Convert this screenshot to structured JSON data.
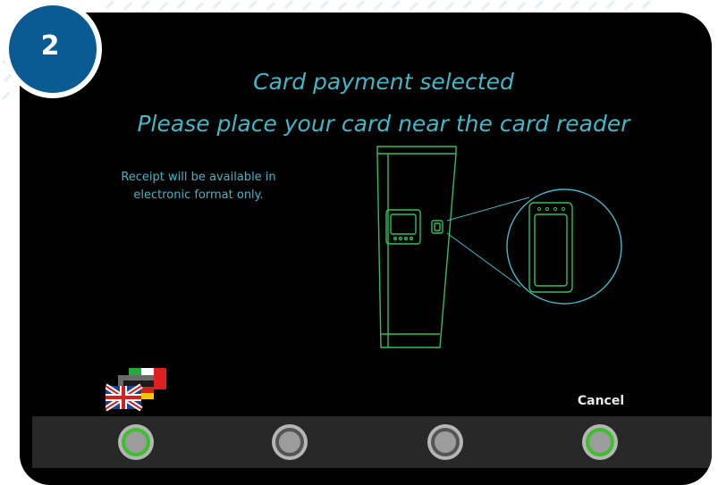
{
  "step": {
    "number": "2"
  },
  "headline": {
    "line1": "Card payment selected",
    "line2": "Please place your card near the card reader"
  },
  "receipt_note": {
    "line1": "Receipt will be available in",
    "line2": "electronic format only."
  },
  "language_selector": {
    "icon": "language-flags-icon",
    "flags": [
      "uk-flag",
      "german-flag",
      "italian-flag",
      "grey-flag"
    ]
  },
  "actions": {
    "cancel_label": "Cancel"
  },
  "soft_keys": [
    {
      "name": "soft-key-1",
      "state": "active"
    },
    {
      "name": "soft-key-2",
      "state": "inactive"
    },
    {
      "name": "soft-key-3",
      "state": "inactive"
    },
    {
      "name": "soft-key-4",
      "state": "active"
    }
  ],
  "colors": {
    "screen_background": "#000000",
    "headline_text": "#3fb8c7",
    "badge_blue": "#0a5b93",
    "kiosk_outline": "#2fc05a",
    "zoom_outline": "#3fb8c7",
    "soft_key_active_ring": "#3fbf2e",
    "bottom_bar": "#282828"
  }
}
